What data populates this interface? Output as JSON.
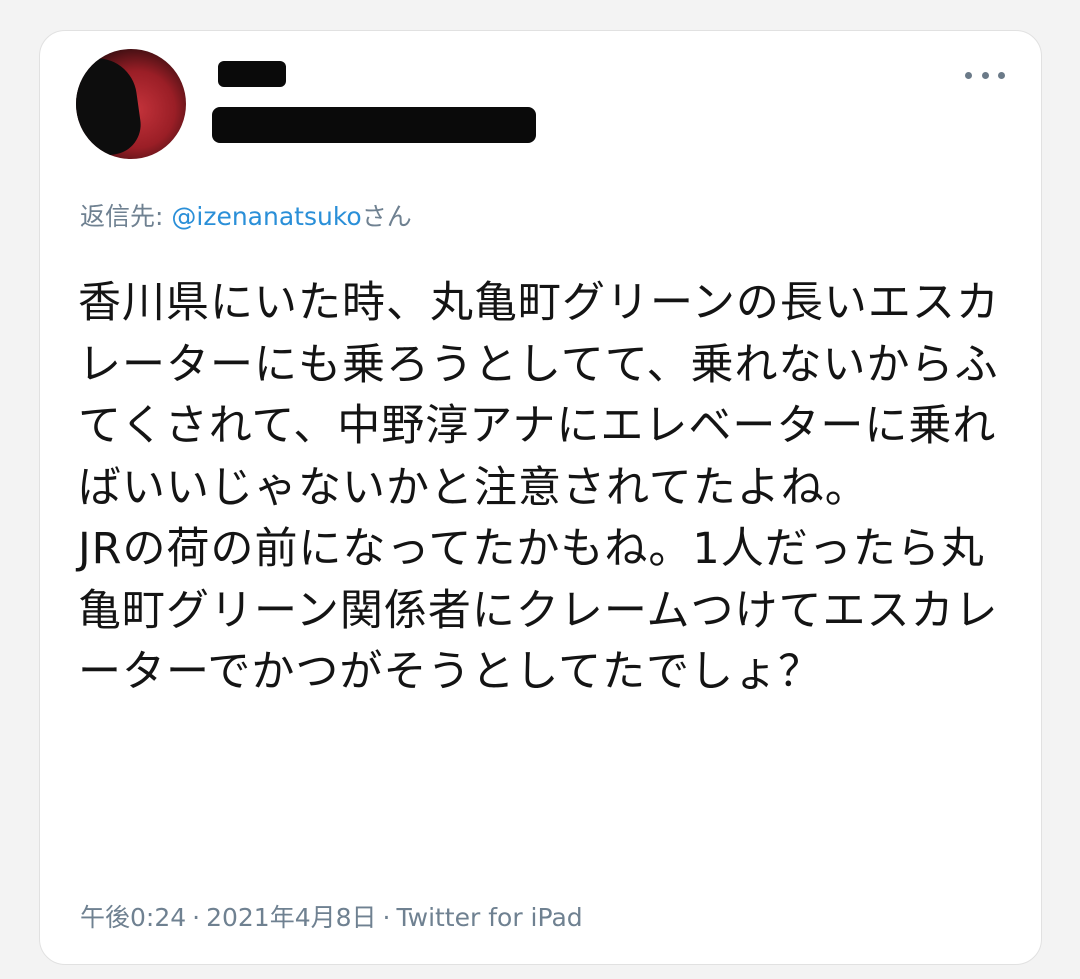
{
  "tweet": {
    "reply_prefix": "返信先: ",
    "reply_handle": "@izenanatsuko",
    "reply_suffix": "さん",
    "text": "香川県にいた時、丸亀町グリーンの長いエスカレーターにも乗ろうとしてて、乗れないからふてくされて、中野淳アナにエレベーターに乗ればいいじゃないかと注意されてたよね。\nJRの荷の前になってたかもね。1人だったら丸亀町グリーン関係者にクレームつけてエスカレーターでかつがそうとしてたでしょ？",
    "time": "午後0:24",
    "separator": "·",
    "date": "2021年4月8日",
    "source": "Twitter for iPad"
  },
  "icons": {
    "more": "more-horizontal-icon"
  },
  "colors": {
    "link": "#2a8fd8",
    "muted": "#6f8191",
    "text": "#141414"
  }
}
